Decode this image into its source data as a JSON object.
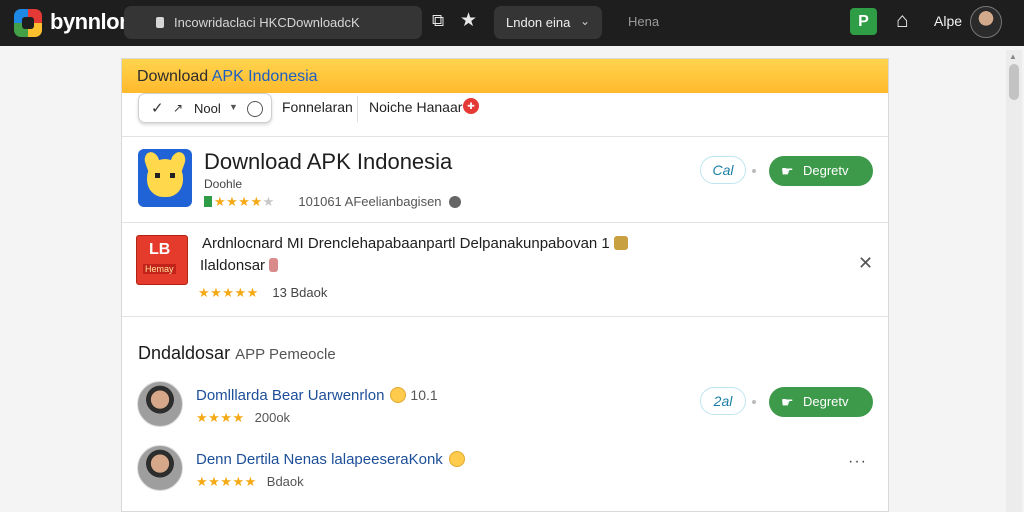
{
  "browser": {
    "brand": "bynnlon",
    "url": "Incowridaclaci HKCDownloadcK",
    "region": "Lndon eina",
    "nav_link": "Hena",
    "user_name": "Alpe",
    "extension_letter": "P"
  },
  "banner": {
    "title_prefix": "Download ",
    "title_accent": "APK Indonesia"
  },
  "filters": {
    "pill_label": "Nool",
    "tab_1": "Fonnelaran",
    "tab_2": "Noiche Hanaar"
  },
  "featured": {
    "title": "Download APK Indonesia",
    "subtitle": "Doohle",
    "stars": "★★★★",
    "stars_dim": "★",
    "meta": "101061 AFeelianbagisen",
    "pill_label": "Cal",
    "install_label": "Degretv"
  },
  "notice": {
    "icon_top": "LB",
    "icon_bottom": "Hemay",
    "text_1": "Ardnlocnard MI Drenclehapabaanpartl Delpanakunpabovan 1",
    "text_2": "Ilaldonsar",
    "stars": "★★★★★",
    "count": "13",
    "count_label": "Bdaok"
  },
  "section": {
    "heading": "Dndaldosar",
    "heading_muted": "APP Pemeocle"
  },
  "list": [
    {
      "title": "Domlllarda Bear Uarwenrlon",
      "title_extra": "10.1",
      "stars": "★★★★",
      "count": "200ok",
      "pill_label": "2al",
      "install_label": "Degretv"
    },
    {
      "title": "Denn Dertila Nenas lalapeeseraKonk",
      "stars": "★★★★★",
      "count": "Bdaok",
      "more": "···"
    }
  ],
  "icons": [
    "logo-icon",
    "lock-icon",
    "share-icon",
    "star-icon",
    "chevron-down-icon",
    "home-icon",
    "check-icon",
    "arrow-icon",
    "clock-icon",
    "close-icon",
    "more-icon",
    "download-icon"
  ],
  "colors": {
    "topbar": "#1e1e1e",
    "banner": "#ffc53a",
    "install": "#3e9a4b",
    "link": "#1d4f99",
    "star": "#f4a915"
  }
}
